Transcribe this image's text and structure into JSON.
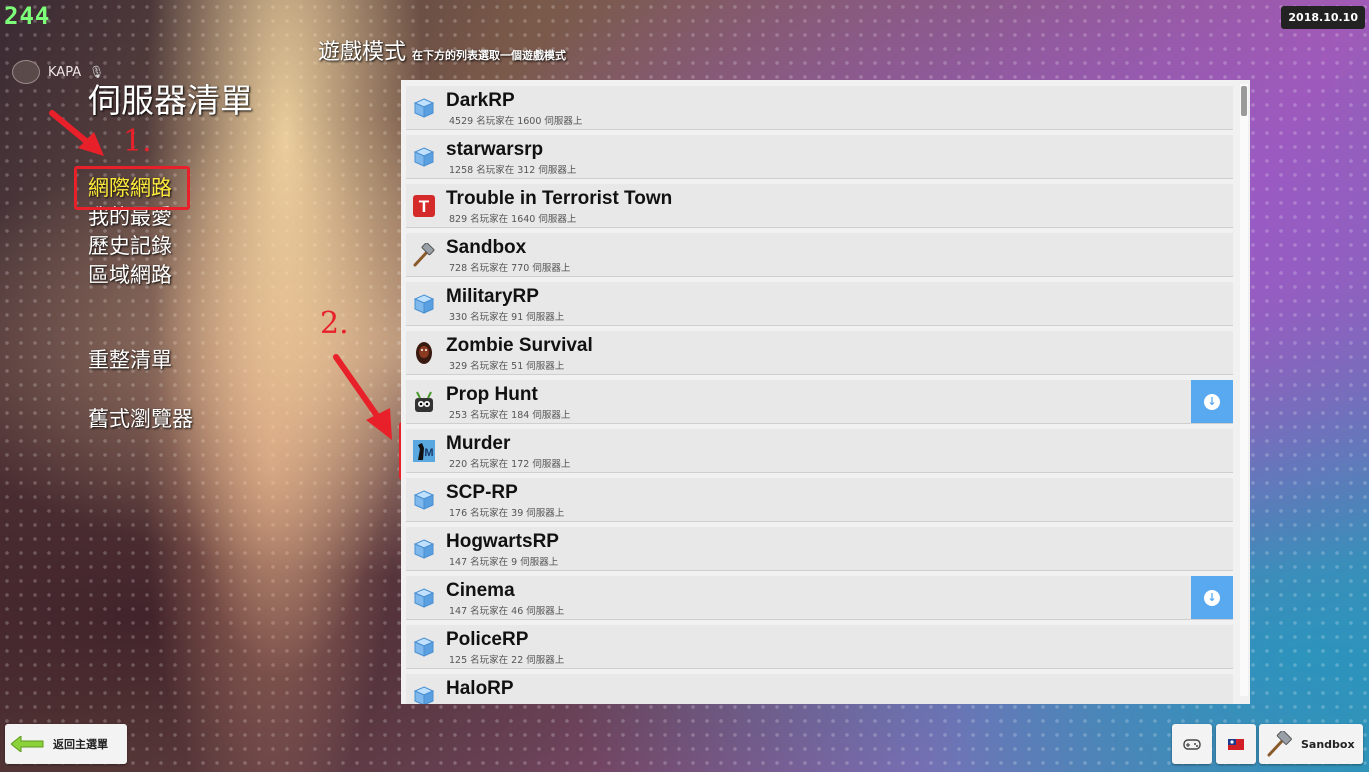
{
  "branding": {
    "logo_text": "244"
  },
  "user": {
    "name": "KAPA",
    "mic_icon": "mic-muted-icon"
  },
  "date_badge": "2018.10.10",
  "left_panel": {
    "title": "伺服器清單",
    "nav": {
      "internet": "網際網路",
      "favorites": "我的最愛",
      "history": "歷史記錄",
      "lan": "區域網路",
      "refresh": "重整清單",
      "legacy_browser": "舊式瀏覽器"
    }
  },
  "game_mode": {
    "title": "遊戲模式",
    "subtitle": "在下方的列表選取一個遊戲模式"
  },
  "annotations": {
    "step1": "1.",
    "step2": "2.",
    "color": "#e8202a"
  },
  "gamemodes": [
    {
      "name": "DarkRP",
      "info": "4529 名玩家在 1600 伺服器上",
      "icon": "cube-icon",
      "download": false
    },
    {
      "name": "starwarsrp",
      "info": "1258 名玩家在 312 伺服器上",
      "icon": "cube-icon",
      "download": false
    },
    {
      "name": "Trouble in Terrorist Town",
      "info": "829 名玩家在 1640 伺服器上",
      "icon": "ttt-icon",
      "download": false
    },
    {
      "name": "Sandbox",
      "info": "728 名玩家在 770 伺服器上",
      "icon": "hammer-icon",
      "download": false
    },
    {
      "name": "MilitaryRP",
      "info": "330 名玩家在 91 伺服器上",
      "icon": "cube-icon",
      "download": false
    },
    {
      "name": "Zombie Survival",
      "info": "329 名玩家在 51 伺服器上",
      "icon": "zombie-icon",
      "download": false
    },
    {
      "name": "Prop Hunt",
      "info": "253 名玩家在 184 伺服器上",
      "icon": "prophunt-icon",
      "download": true
    },
    {
      "name": "Murder",
      "info": "220 名玩家在 172 伺服器上",
      "icon": "murder-icon",
      "download": false
    },
    {
      "name": "SCP-RP",
      "info": "176 名玩家在 39 伺服器上",
      "icon": "cube-icon",
      "download": false
    },
    {
      "name": "HogwartsRP",
      "info": "147 名玩家在 9 伺服器上",
      "icon": "cube-icon",
      "download": false
    },
    {
      "name": "Cinema",
      "info": "147 名玩家在 46 伺服器上",
      "icon": "cube-icon",
      "download": true
    },
    {
      "name": "PoliceRP",
      "info": "125 名玩家在 22 伺服器上",
      "icon": "cube-icon",
      "download": false
    },
    {
      "name": "HaloRP",
      "info": "",
      "icon": "cube-icon",
      "download": false
    }
  ],
  "bottom": {
    "back_label": "返回主選單",
    "current_mode_label": "Sandbox"
  },
  "colors": {
    "download_blue": "#59a9f0",
    "active_nav": "#ffeb3b"
  }
}
